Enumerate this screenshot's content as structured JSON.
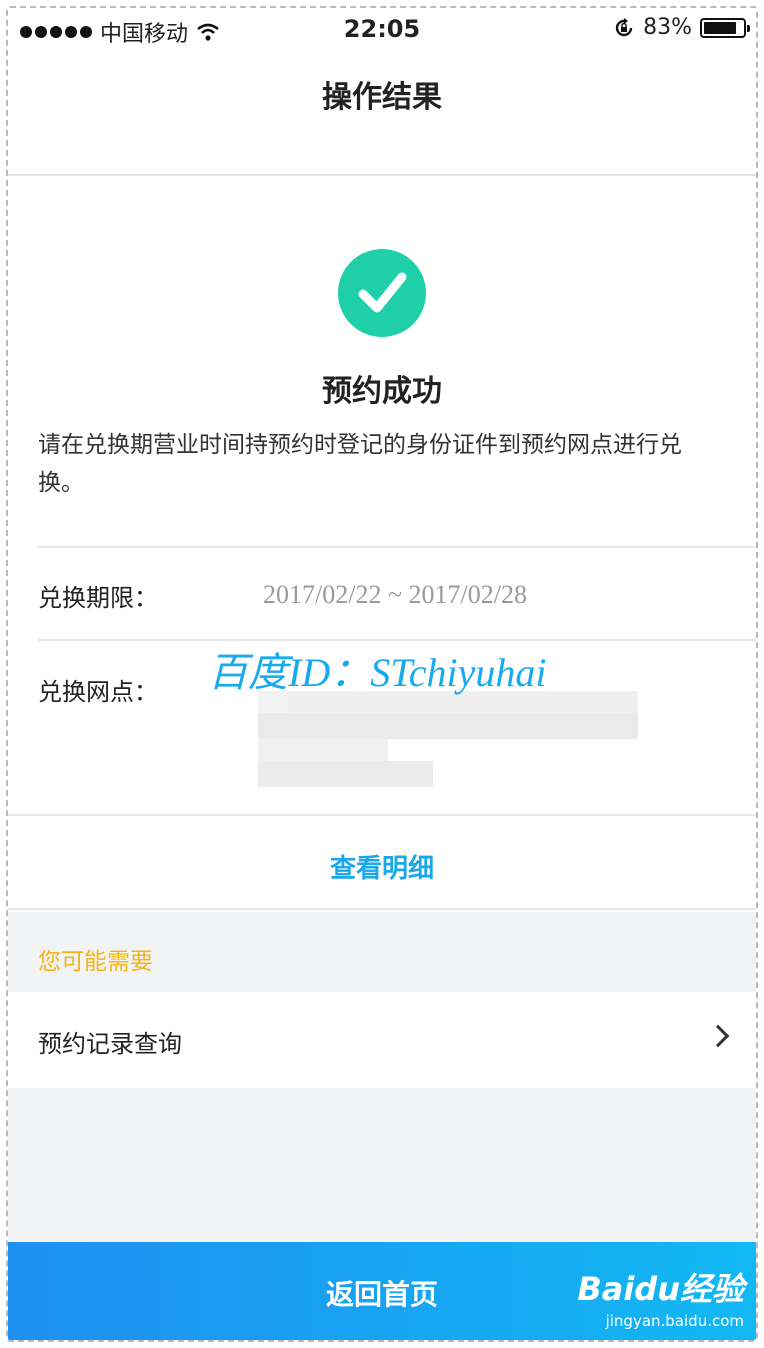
{
  "status_bar": {
    "carrier": "中国移动",
    "time": "22:05",
    "battery_percent": "83%",
    "battery_level": 0.83
  },
  "nav": {
    "title": "操作结果"
  },
  "result": {
    "title": "预约成功",
    "description": "请在兑换期营业时间持预约时登记的身份证件到预约网点进行兑换。"
  },
  "details": {
    "period_label": "兑换期限：",
    "period_value": "2017/02/22 ~ 2017/02/28",
    "branch_label": "兑换网点："
  },
  "watermark": {
    "id_text": "百度ID：STchiyuhai"
  },
  "view_detail_link": "查看明细",
  "suggestions": {
    "header": "您可能需要",
    "items": [
      {
        "label": "预约记录查询"
      }
    ]
  },
  "bottom_button": {
    "label": "返回首页"
  },
  "baidu_logo": {
    "brand": "Baidu经验",
    "url": "jingyan.baidu.com"
  },
  "colors": {
    "success": "#1fcfa7",
    "link": "#1ca7e9",
    "section_header": "#f5b418",
    "button": "#1e8ff0"
  }
}
